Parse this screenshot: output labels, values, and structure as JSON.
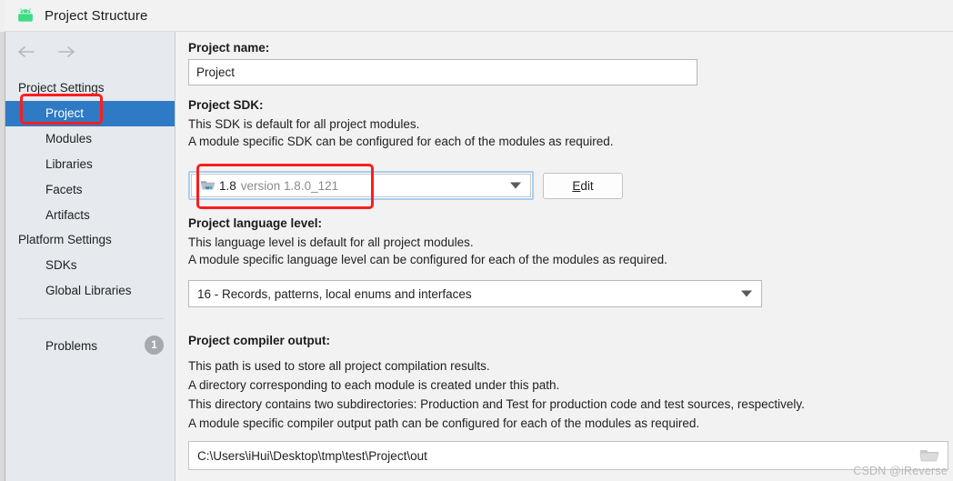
{
  "window": {
    "title": "Project Structure",
    "icon": "android-robot-icon"
  },
  "sidebar": {
    "nav": {
      "back": "back-arrow",
      "forward": "forward-arrow"
    },
    "groups": [
      {
        "header": "Project Settings",
        "items": [
          {
            "label": "Project",
            "selected": true
          },
          {
            "label": "Modules",
            "selected": false
          },
          {
            "label": "Libraries",
            "selected": false
          },
          {
            "label": "Facets",
            "selected": false
          },
          {
            "label": "Artifacts",
            "selected": false
          }
        ]
      },
      {
        "header": "Platform Settings",
        "items": [
          {
            "label": "SDKs",
            "selected": false
          },
          {
            "label": "Global Libraries",
            "selected": false
          }
        ]
      }
    ],
    "problems": {
      "label": "Problems",
      "count": "1"
    }
  },
  "main": {
    "project_name": {
      "label": "Project name:",
      "value": "Project"
    },
    "project_sdk": {
      "label": "Project SDK:",
      "desc_line1": "This SDK is default for all project modules.",
      "desc_line2": "A module specific SDK can be configured for each of the modules as required.",
      "selected_name": "1.8",
      "selected_version": "version 1.8.0_121",
      "icon": "java-sdk-folder-icon",
      "edit_button": {
        "mnemonic": "E",
        "rest": "dit"
      }
    },
    "language_level": {
      "label": "Project language level:",
      "desc_line1": "This language level is default for all project modules.",
      "desc_line2": "A module specific language level can be configured for each of the modules as required.",
      "selected": "16 - Records, patterns, local enums and interfaces"
    },
    "compiler_output": {
      "label": "Project compiler output:",
      "desc_line1": "This path is used to store all project compilation results.",
      "desc_line2": "A directory corresponding to each module is created under this path.",
      "desc_line3": "This directory contains two subdirectories: Production and Test for production code and test sources, respectively.",
      "desc_line4": "A module specific compiler output path can be configured for each of the modules as required.",
      "path": "C:\\Users\\iHui\\Desktop\\tmp\\test\\Project\\out",
      "browse_icon": "folder-browse-icon"
    }
  },
  "watermark": "CSDN @iReverse",
  "colors": {
    "selection_blue": "#2f7ac4",
    "annotation_red": "#fc1d1d",
    "sidebar_bg": "#e6eaee",
    "panel_bg": "#f2f2f2",
    "badge_gray": "#a6aaae"
  }
}
